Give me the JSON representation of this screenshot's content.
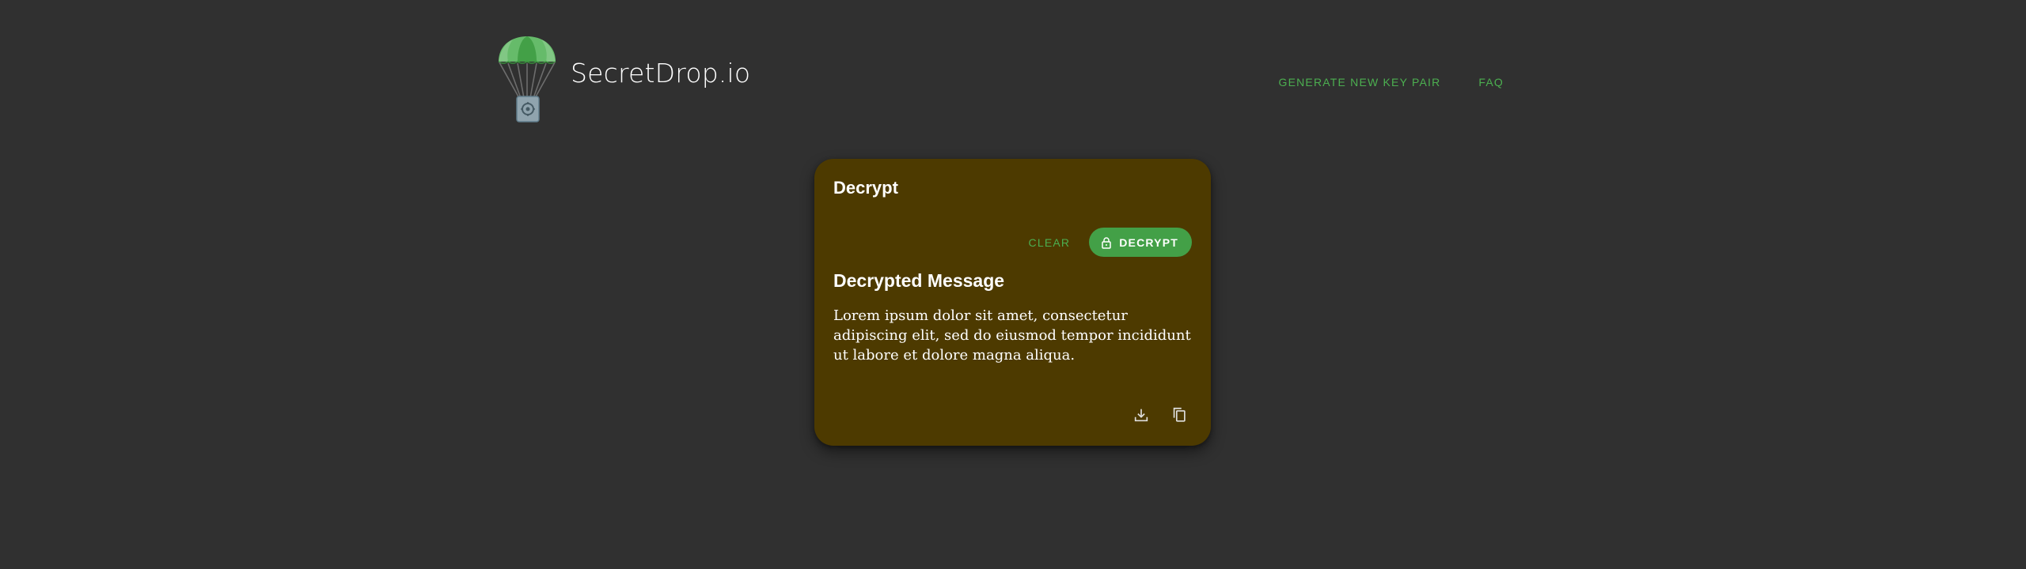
{
  "header": {
    "brand_name": "SecretDrop.io",
    "logo_icon": "parachute-lock-icon",
    "nav": [
      {
        "label": "GENERATE NEW KEY PAIR"
      },
      {
        "label": "FAQ"
      }
    ]
  },
  "card": {
    "title": "Decrypt",
    "clear_label": "CLEAR",
    "decrypt_label": "DECRYPT",
    "decrypt_icon": "lock-icon",
    "section_title": "Decrypted Message",
    "message": "Lorem ipsum dolor sit amet, consectetur adipiscing elit, sed do eiusmod tempor incididunt ut labore et dolore magna aliqua.",
    "download_icon": "download-icon",
    "copy_icon": "copy-icon"
  },
  "colors": {
    "background": "#303030",
    "card_background": "#4d3a00",
    "accent_green": "#4caf50",
    "button_green": "#43a047",
    "text": "#ffffff"
  }
}
